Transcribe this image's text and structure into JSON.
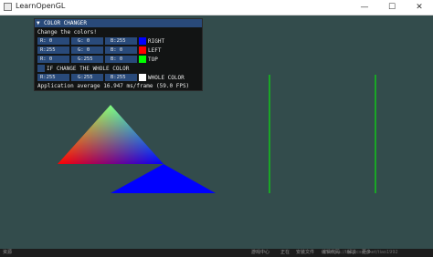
{
  "window": {
    "title": "LearnOpenGL",
    "controls": {
      "minimize": "—",
      "maximize": "☐",
      "close": "✕"
    }
  },
  "panel": {
    "arrow": "▼",
    "title": "COLOR CHANGER",
    "prompt": "Change the colors!",
    "rows": [
      {
        "r": "R:  0",
        "g": "G:  0",
        "b": "B:255",
        "label": "RIGHT",
        "swatch": "#0000ff"
      },
      {
        "r": "R:255",
        "g": "G:  0",
        "b": "B:  0",
        "label": "LEFT",
        "swatch": "#ff0000"
      },
      {
        "r": "R:  0",
        "g": "G:255",
        "b": "B:  0",
        "label": "TOP",
        "swatch": "#00ff00"
      }
    ],
    "checkbox_label": "IF CHANGE THE WHOLE COLOR",
    "whole": {
      "r": "R:255",
      "g": "G:255",
      "b": "B:255",
      "label": "WHOLE COLOR",
      "swatch": "#ffffff"
    },
    "fps_text": "Application average 16.947 ms/frame (59.0 FPS)"
  },
  "scene": {
    "background": "#334c4c",
    "triangle_colors": {
      "top": "#00ff00",
      "left": "#ff0000",
      "right": "#0000ff"
    },
    "second_triangle_color": "#0000ff",
    "line_color": "#00ff00"
  },
  "taskbar": {
    "left_text": "资源",
    "items": [
      "游戏中心",
      "正在",
      "安装文件",
      "编辑代码",
      "解决",
      "更多"
    ],
    "watermark": "https://blog.csdn.net/tiao1992"
  }
}
